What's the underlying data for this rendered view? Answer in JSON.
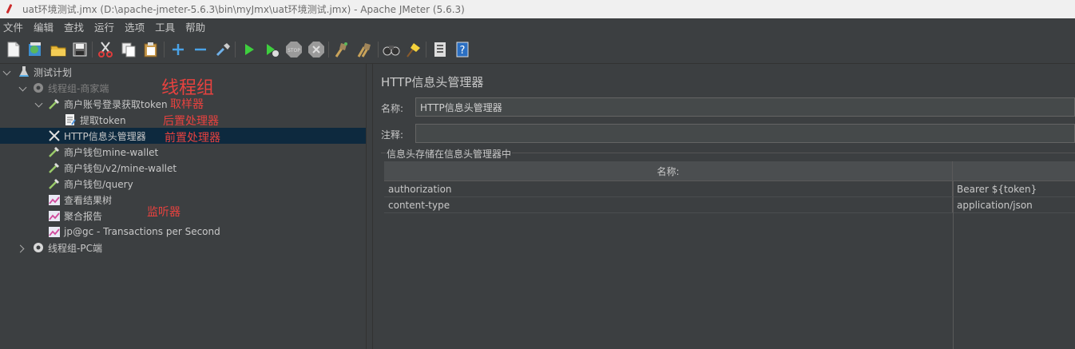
{
  "window": {
    "title": "uat环境测试.jmx (D:\\apache-jmeter-5.6.3\\bin\\myJmx\\uat环境测试.jmx) - Apache JMeter (5.6.3)"
  },
  "menu": [
    "文件",
    "编辑",
    "查找",
    "运行",
    "选项",
    "工具",
    "帮助"
  ],
  "toolbar_icons": [
    "new-icon",
    "templates-icon",
    "open-icon",
    "save-icon",
    "cut-icon",
    "copy-icon",
    "paste-icon",
    "expand-icon",
    "collapse-icon",
    "toggle-icon",
    "start-icon",
    "start-no-pause-icon",
    "stop-icon",
    "shutdown-icon",
    "clear-icon",
    "clear-all-icon",
    "search-icon",
    "reset-search-icon",
    "function-helper-icon",
    "help-icon"
  ],
  "tree": {
    "root": "测试计划",
    "thread_group_1": "线程组-商家端",
    "sampler": "商户账号登录获取token",
    "extractor": "提取token",
    "header_manager": "HTTP信息头管理器",
    "sampler_2": "商户钱包mine-wallet",
    "sampler_3": "商户钱包/v2/mine-wallet",
    "sampler_4": "商户钱包/query",
    "listener_1": "查看结果树",
    "listener_2": "聚合报告",
    "listener_3": "jp@gc - Transactions per Second",
    "thread_group_2": "线程组-PC端"
  },
  "annotations": {
    "thread_group": "线程组",
    "sampler": "取样器",
    "post_processor": "后置处理器",
    "pre_processor": "前置处理器",
    "listener": "监听器"
  },
  "panel": {
    "title": "HTTP信息头管理器",
    "name_label": "名称:",
    "name_value": "HTTP信息头管理器",
    "comment_label": "注释:",
    "comment_value": "",
    "group_title": "信息头存储在信息头管理器中",
    "table": {
      "columns": [
        "名称:",
        ""
      ],
      "rows": [
        {
          "name": "authorization",
          "value": "Bearer ${token}"
        },
        {
          "name": "content-type",
          "value": "application/json"
        }
      ]
    }
  },
  "colors": {
    "background": "#3c3f41",
    "selection": "#0d293e",
    "annotation": "#e8423f",
    "titlebar": "#f0f0f0"
  }
}
